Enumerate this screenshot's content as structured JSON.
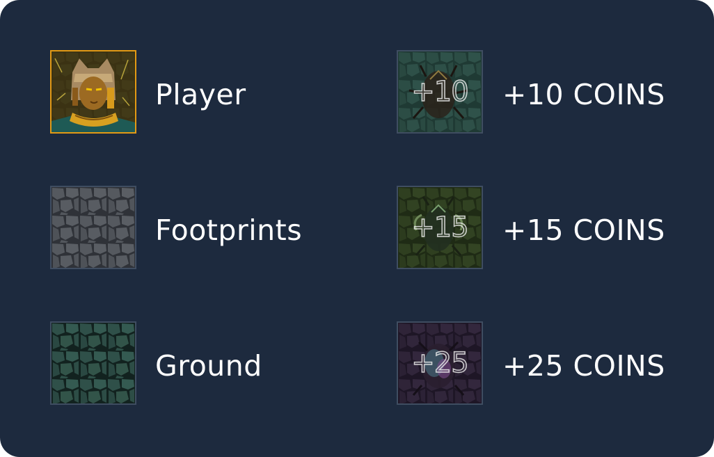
{
  "legend": {
    "left": [
      {
        "key": "player",
        "label": "Player",
        "icon": "pharaoh-cat-player-icon"
      },
      {
        "key": "footprints",
        "label": "Footprints",
        "icon": "grey-stone-tile-icon"
      },
      {
        "key": "ground",
        "label": "Ground",
        "icon": "green-stone-tile-icon"
      }
    ],
    "right": [
      {
        "key": "coin10",
        "badge": "+10",
        "label": "+10 COINS",
        "icon": "scarab-teal-icon"
      },
      {
        "key": "coin15",
        "badge": "+15",
        "label": "+15 COINS",
        "icon": "scarab-green-icon"
      },
      {
        "key": "coin25",
        "badge": "+25",
        "label": "+25 COINS",
        "icon": "scarab-purple-icon"
      }
    ]
  },
  "colors": {
    "panel_bg": "#1d2a3e",
    "player_border": "#e39a14",
    "tile_border": "#3f4d61",
    "ground_green": "#2c4a42",
    "footprint_grey": "#4a4e55",
    "coin10_bg": "#2a4a42",
    "coin15_bg": "#2c3a1e",
    "coin25_bg": "#2e2236"
  }
}
